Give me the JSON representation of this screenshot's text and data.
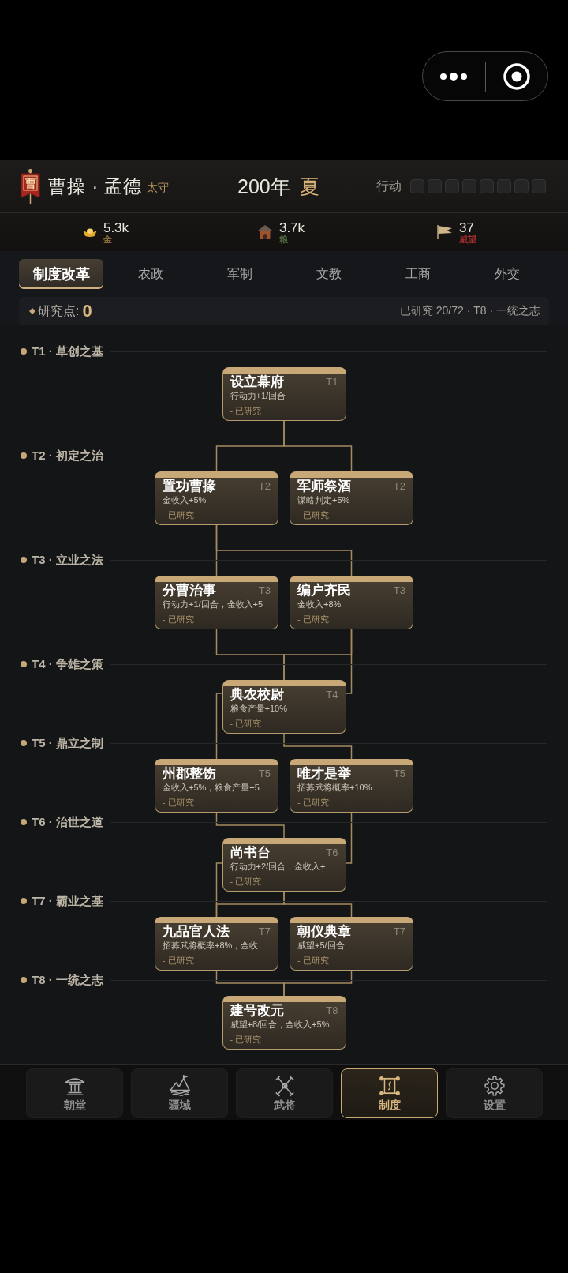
{
  "header": {
    "banner": "曹",
    "name": "曹操 · 孟德",
    "rank": "太守",
    "year": "200年",
    "season": "夏",
    "actions_label": "行动",
    "action_slots": [
      {
        "filled": false
      },
      {
        "filled": false
      },
      {
        "filled": false
      },
      {
        "filled": false
      },
      {
        "filled": false
      },
      {
        "filled": false
      },
      {
        "filled": false
      },
      {
        "filled": false
      }
    ]
  },
  "resources": [
    {
      "value": "5.3k",
      "label": "金",
      "color": "#8a6d3b"
    },
    {
      "value": "3.7k",
      "label": "粮",
      "color": "#4f6a3c"
    },
    {
      "value": "37",
      "label": "威望",
      "color": "#a52e2e"
    }
  ],
  "tabs": [
    {
      "label": "制度改革",
      "selected": true
    },
    {
      "label": "农政",
      "selected": false
    },
    {
      "label": "军制",
      "selected": false
    },
    {
      "label": "文教",
      "selected": false
    },
    {
      "label": "工商",
      "selected": false
    },
    {
      "label": "外交",
      "selected": false
    }
  ],
  "research": {
    "points_label": "研究点:",
    "points": "0",
    "progress": "已研究 20/72 · T8 · 一统之志"
  },
  "tiers": [
    {
      "label": "T1 · 草创之基",
      "nodes": [
        {
          "title": "设立幕府",
          "tier": "T1",
          "effect": "行动力+1/回合",
          "status": "- 已研究",
          "researched": true
        }
      ]
    },
    {
      "label": "T2 · 初定之治",
      "nodes": [
        {
          "title": "置功曹掾",
          "tier": "T2",
          "effect": "金收入+5%",
          "status": "- 已研究",
          "researched": true
        },
        {
          "title": "军师祭酒",
          "tier": "T2",
          "effect": "谋略判定+5%",
          "status": "- 已研究",
          "researched": true
        }
      ]
    },
    {
      "label": "T3 · 立业之法",
      "nodes": [
        {
          "title": "分曹治事",
          "tier": "T3",
          "effect": "行动力+1/回合，金收入+5",
          "status": "- 已研究",
          "researched": true
        },
        {
          "title": "编户齐民",
          "tier": "T3",
          "effect": "金收入+8%",
          "status": "- 已研究",
          "researched": true
        }
      ]
    },
    {
      "label": "T4 · 争雄之策",
      "nodes": [
        {
          "title": "典农校尉",
          "tier": "T4",
          "effect": "粮食产量+10%",
          "status": "- 已研究",
          "researched": true
        }
      ]
    },
    {
      "label": "T5 · 鼎立之制",
      "nodes": [
        {
          "title": "州郡整饬",
          "tier": "T5",
          "effect": "金收入+5%，粮食产量+5",
          "status": "- 已研究",
          "researched": true
        },
        {
          "title": "唯才是举",
          "tier": "T5",
          "effect": "招募武将概率+10%",
          "status": "- 已研究",
          "researched": true
        }
      ]
    },
    {
      "label": "T6 · 治世之道",
      "nodes": [
        {
          "title": "尚书台",
          "tier": "T6",
          "effect": "行动力+2/回合，金收入+",
          "status": "- 已研究",
          "researched": true
        }
      ]
    },
    {
      "label": "T7 · 霸业之基",
      "nodes": [
        {
          "title": "九品官人法",
          "tier": "T7",
          "effect": "招募武将概率+8%，金收",
          "status": "- 已研究",
          "researched": true
        },
        {
          "title": "朝仪典章",
          "tier": "T7",
          "effect": "威望+5/回合",
          "status": "- 已研究",
          "researched": true
        }
      ]
    },
    {
      "label": "T8 · 一统之志",
      "nodes": [
        {
          "title": "建号改元",
          "tier": "T8",
          "effect": "威望+8/回合，金收入+5%",
          "status": "- 已研究",
          "researched": true
        }
      ]
    }
  ],
  "nav": [
    {
      "label": "朝堂",
      "selected": false
    },
    {
      "label": "疆域",
      "selected": false
    },
    {
      "label": "武将",
      "selected": false
    },
    {
      "label": "制度",
      "selected": true
    },
    {
      "label": "设置",
      "selected": false
    }
  ]
}
